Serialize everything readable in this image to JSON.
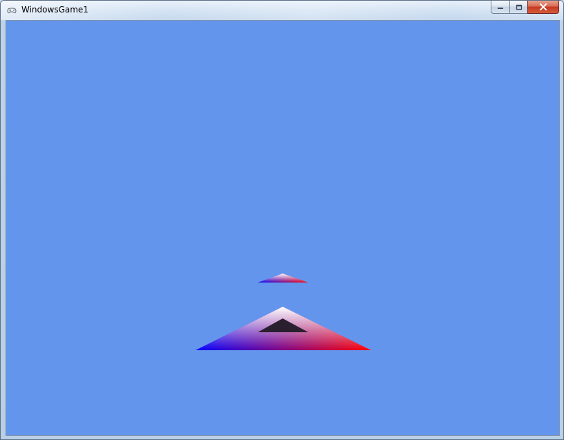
{
  "window": {
    "title": "WindowsGame1",
    "app_icon": "gamepad-icon",
    "caption_buttons": [
      {
        "name": "minimize",
        "icon": "minimize-icon"
      },
      {
        "name": "maximize",
        "icon": "maximize-icon"
      },
      {
        "name": "close",
        "icon": "close-icon"
      }
    ]
  },
  "game": {
    "clear_color": "#6495ED",
    "vertex_colors": {
      "top": "#FFFFFF",
      "left": "#0000FF",
      "right": "#FF0000"
    },
    "shadow_color": "#2a1f2e"
  }
}
